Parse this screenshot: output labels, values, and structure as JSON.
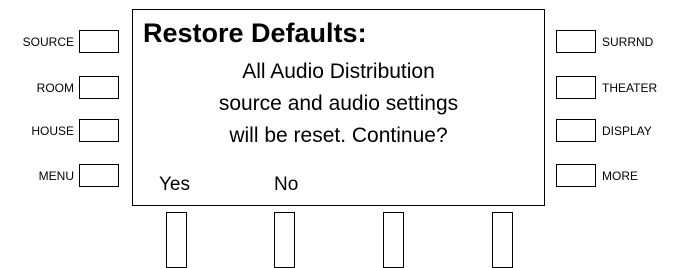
{
  "left_buttons": [
    {
      "label": "SOURCE"
    },
    {
      "label": "ROOM"
    },
    {
      "label": "HOUSE"
    },
    {
      "label": "MENU"
    }
  ],
  "right_buttons": [
    {
      "label": "SURRND"
    },
    {
      "label": "THEATER"
    },
    {
      "label": "DISPLAY"
    },
    {
      "label": "MORE"
    }
  ],
  "screen": {
    "title": "Restore Defaults:",
    "message_lines": [
      "All Audio Distribution",
      "source and audio settings",
      "will be reset. Continue?"
    ],
    "softkeys": {
      "yes": "Yes",
      "no": "No"
    }
  },
  "bottom_buttons": [
    {
      "name": "softkey-1"
    },
    {
      "name": "softkey-2"
    },
    {
      "name": "softkey-3"
    },
    {
      "name": "softkey-4"
    }
  ]
}
